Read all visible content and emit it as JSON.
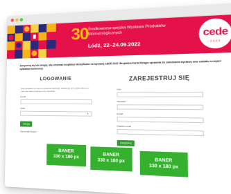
{
  "hero": {
    "edition_number": "30",
    "title": "Środkowoeuropejska Wystawa Produktów Stomatologicznych",
    "date_location": "Łódź, 22–24.09.2022",
    "logo_text": "cede",
    "logo_subtext": "2022"
  },
  "intro": {
    "text": "Zarejestruj się lub zaloguj, aby otrzymać bezpłatny identyfikator na wystawę CEDE 2022. Bezpłatna Karta Wstępu uprawnia do zwiedzania wystawy oraz udziału w części wykładów konferencji."
  },
  "login": {
    "heading": "LOGOWANIE",
    "note": "Jeśli posiadasz już konto w systemie rejestracji, zaloguj się przy użyciu adresu e-mail oraz hasła podanego przy rejestracji.",
    "email_label": "E-mail",
    "password_label": "Hasło",
    "submit_label": "Zaloguj",
    "forgot_label": "Zapomniałeś hasła?"
  },
  "register": {
    "heading": "ZAREJESTRUJ SIĘ",
    "first_name_label": "Imię",
    "last_name_label": "Nazwisko",
    "email_label": "E-mail",
    "password_label": "Powtórz e-mail",
    "submit_label": "Zarejestruj"
  },
  "banners": [
    {
      "title": "BANER",
      "size": "330 x 180 px"
    },
    {
      "title": "BANER",
      "size": "330 x 180 px"
    },
    {
      "title": "BANER",
      "size": "330 x 180 px"
    }
  ],
  "colors": {
    "brand_red": "#e5114a",
    "accent_yellow": "#f7b418",
    "banner_green": "#36b12f",
    "button_green": "#2e9b2b"
  }
}
